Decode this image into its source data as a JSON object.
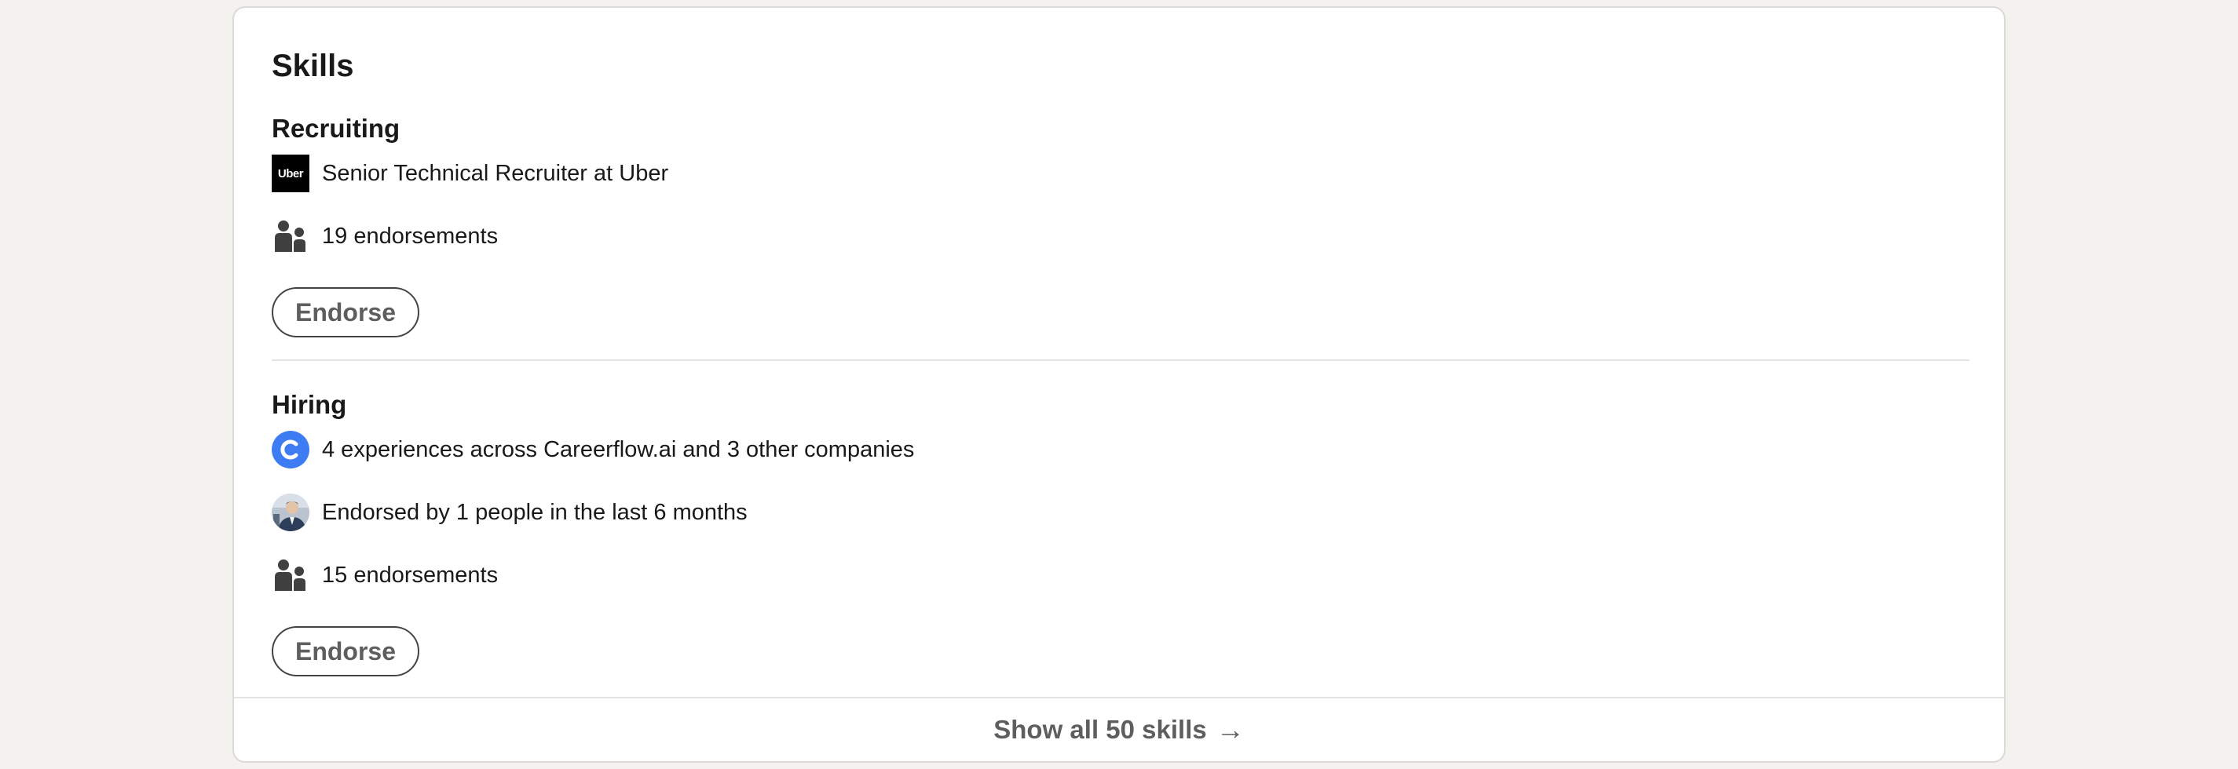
{
  "section": {
    "title": "Skills"
  },
  "skills": [
    {
      "name": "Recruiting",
      "company_logo_text": "Uber",
      "experience_text": "Senior Technical Recruiter at Uber",
      "endorsements_text": "19 endorsements",
      "endorse_label": "Endorse"
    },
    {
      "name": "Hiring",
      "company_logo_icon": "careerflow-logo-icon",
      "experience_text": "4 experiences across Careerflow.ai and 3 other companies",
      "endorsed_by_text": "Endorsed by 1 people in the last 6 months",
      "endorsements_text": "15 endorsements",
      "endorse_label": "Endorse"
    }
  ],
  "footer": {
    "show_all_label": "Show all 50 skills",
    "arrow": "→"
  },
  "icons": {
    "people": "people-icon",
    "company_uber": "uber-logo-icon",
    "company_careerflow": "careerflow-logo-icon",
    "endorser_avatar": "avatar"
  },
  "colors": {
    "careerflow_blue": "#3d7cf2",
    "uber_black": "#000000",
    "page_background": "#f3f2ef"
  }
}
